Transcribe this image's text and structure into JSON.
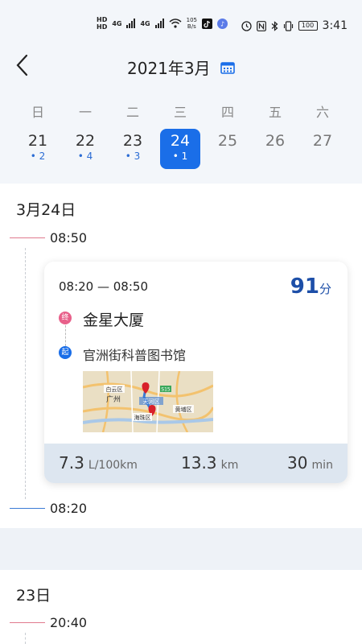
{
  "status_bar": {
    "hd_labels": [
      "HD",
      "HD"
    ],
    "network": [
      "4G",
      "4G"
    ],
    "speed_value": "105",
    "speed_unit": "B/s",
    "battery": "100",
    "time": "3:41"
  },
  "header": {
    "title": "2021年3月",
    "icons": {
      "back": "back-arrow-icon",
      "calendar": "calendar-icon"
    }
  },
  "week": {
    "weekdays": [
      "日",
      "一",
      "二",
      "三",
      "四",
      "五",
      "六"
    ],
    "days": [
      {
        "num": "21",
        "count": "• 2"
      },
      {
        "num": "22",
        "count": "• 4"
      },
      {
        "num": "23",
        "count": "• 3"
      },
      {
        "num": "24",
        "count": "• 1"
      },
      {
        "num": "25",
        "count": ""
      },
      {
        "num": "26",
        "count": ""
      },
      {
        "num": "27",
        "count": ""
      }
    ],
    "selected_index": 3
  },
  "section1": {
    "date": "3月24日",
    "time_top": "08:50",
    "time_bottom": "08:20",
    "trip": {
      "time_range": "08:20 — 08:50",
      "minutes": "91",
      "minutes_unit": "分",
      "end_badge": "终",
      "end_name": "金星大厦",
      "start_badge": "起",
      "start_name": "官洲街科普图书馆",
      "fuel_value": "7.3",
      "fuel_unit": "L/100km",
      "distance_value": "13.3",
      "distance_unit": "km",
      "duration_value": "30",
      "duration_unit": "min",
      "map_labels": {
        "district1": "白云区",
        "city": "广州",
        "district2": "天河区",
        "district3": "海珠区",
        "district4": "黄埔区",
        "road": "S15"
      }
    }
  },
  "section2": {
    "date": "23日",
    "time_top": "20:40"
  },
  "colors": {
    "accent": "#1a6ee8",
    "end_badge": "#e8608a",
    "minutes": "#1d4fa8",
    "stats_bg": "#dde6f0"
  }
}
